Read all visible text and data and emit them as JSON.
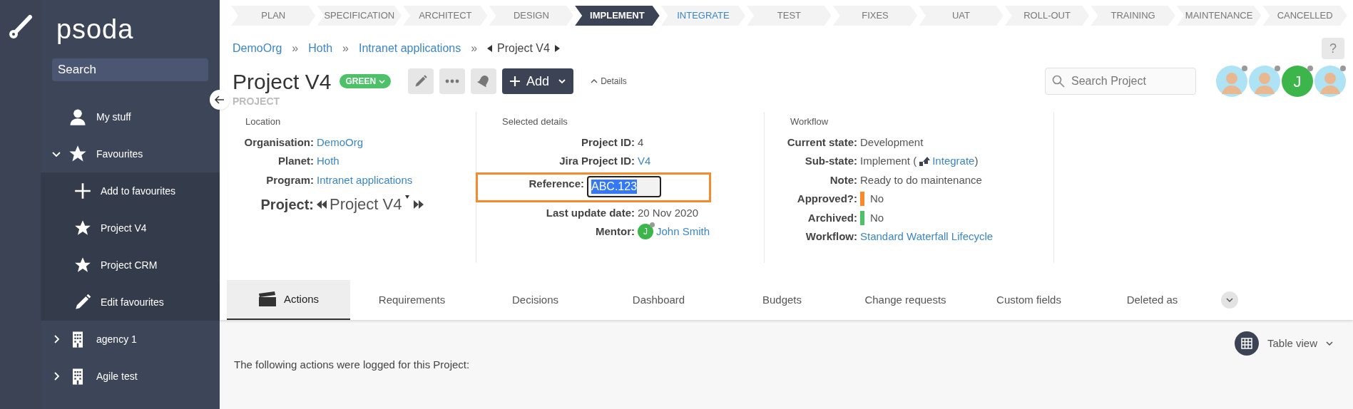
{
  "sidebar": {
    "logo": "psoda",
    "search": {
      "placeholder": "Search"
    },
    "items": [
      {
        "label": "My stuff",
        "kind": "user"
      },
      {
        "label": "Favourites",
        "kind": "star",
        "expanded": true,
        "children": [
          {
            "label": "Add to favourites",
            "kind": "plus"
          },
          {
            "label": "Project V4",
            "kind": "star"
          },
          {
            "label": "Project CRM",
            "kind": "star"
          },
          {
            "label": "Edit favourites",
            "kind": "pencil"
          }
        ]
      },
      {
        "label": "agency 1",
        "kind": "building",
        "expanded": false
      },
      {
        "label": "Agile test",
        "kind": "building",
        "expanded": false
      }
    ]
  },
  "stages": [
    {
      "label": "PLAN",
      "selected": false,
      "kind": "plain"
    },
    {
      "label": "SPECIFICATION",
      "selected": false,
      "kind": "plain"
    },
    {
      "label": "ARCHITECT",
      "selected": false,
      "kind": "plain"
    },
    {
      "label": "DESIGN",
      "selected": false,
      "kind": "plain"
    },
    {
      "label": "IMPLEMENT",
      "selected": true,
      "kind": "plain"
    },
    {
      "label": "INTEGRATE",
      "selected": false,
      "kind": "next"
    },
    {
      "label": "TEST",
      "selected": false,
      "kind": "plain"
    },
    {
      "label": "FIXES",
      "selected": false,
      "kind": "plain"
    },
    {
      "label": "UAT",
      "selected": false,
      "kind": "plain"
    },
    {
      "label": "ROLL-OUT",
      "selected": false,
      "kind": "plain"
    },
    {
      "label": "TRAINING",
      "selected": false,
      "kind": "plain"
    },
    {
      "label": "MAINTENANCE",
      "selected": false,
      "kind": "plain"
    },
    {
      "label": "CANCELLED",
      "selected": false,
      "kind": "plain"
    }
  ],
  "breadcrumb": {
    "links": [
      "DemoOrg",
      "Hoth",
      "Intranet applications"
    ],
    "separator": "»",
    "current": "Project V4"
  },
  "help": "?",
  "header": {
    "title": "Project V4",
    "status": "GREEN",
    "subtitle": "PROJECT",
    "add": "Add",
    "details_toggle": "Details",
    "search": {
      "placeholder": "Search Project"
    },
    "avatars": [
      {
        "kind": "photo"
      },
      {
        "kind": "photo"
      },
      {
        "kind": "initial",
        "initial": "J"
      },
      {
        "kind": "photo"
      }
    ]
  },
  "details": {
    "location": {
      "heading": "Location",
      "fields": [
        {
          "label": "Organisation:",
          "value": "DemoOrg",
          "link": true
        },
        {
          "label": "Planet:",
          "value": "Hoth",
          "link": true
        },
        {
          "label": "Program:",
          "value": "Intranet applications",
          "link": true
        }
      ],
      "project_label": "Project:",
      "project_value": "Project V4"
    },
    "selected": {
      "heading": "Selected details",
      "fields": [
        {
          "kind": "text",
          "label": "Project ID:",
          "value": "4",
          "link": false
        },
        {
          "kind": "text",
          "label": "Jira Project ID:",
          "value": "V4",
          "link": true
        },
        {
          "kind": "input",
          "label": "Reference:",
          "value": "ABC.123",
          "highlighted": true
        },
        {
          "kind": "text",
          "label": "Last update date:",
          "value": "20 Nov 2020",
          "link": false
        },
        {
          "kind": "person",
          "label": "Mentor:",
          "value": "John Smith",
          "initial": "J",
          "link": true
        }
      ]
    },
    "workflow": {
      "heading": "Workflow",
      "fields": [
        {
          "kind": "text",
          "label": "Current state:",
          "value": "Development"
        },
        {
          "kind": "substate",
          "label": "Sub-state:",
          "value": "Implement (",
          "link_text": "Integrate",
          "suffix": ")"
        },
        {
          "kind": "text",
          "label": "Note:",
          "value": "Ready to do maintenance"
        },
        {
          "kind": "flag",
          "label": "Approved?:",
          "value": "No",
          "color": "#f98a2c"
        },
        {
          "kind": "flag",
          "label": "Archived:",
          "value": "No",
          "color": "#4cc167"
        },
        {
          "kind": "link",
          "label": "Workflow:",
          "value": "Standard Waterfall Lifecycle"
        }
      ]
    }
  },
  "tabs": [
    {
      "label": "Actions",
      "selected": true
    },
    {
      "label": "Requirements",
      "selected": false
    },
    {
      "label": "Decisions",
      "selected": false
    },
    {
      "label": "Dashboard",
      "selected": false
    },
    {
      "label": "Budgets",
      "selected": false
    },
    {
      "label": "Change requests",
      "selected": false
    },
    {
      "label": "Custom fields",
      "selected": false
    },
    {
      "label": "Deleted as",
      "selected": false
    }
  ],
  "view": "Table view",
  "message": "The following actions were logged for this Project:"
}
